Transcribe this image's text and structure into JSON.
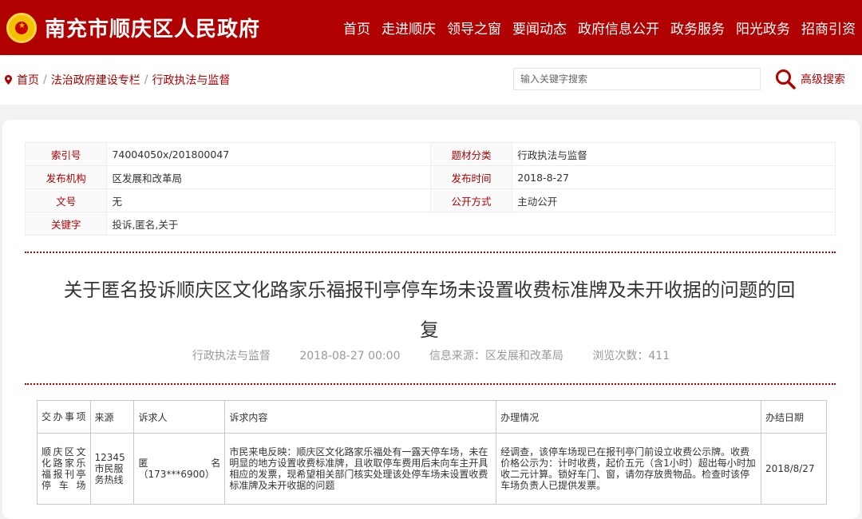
{
  "header": {
    "site_name": "南充市顺庆区人民政府",
    "nav": [
      "首页",
      "走进顺庆",
      "领导之窗",
      "要闻动态",
      "政府信息公开",
      "政务服务",
      "阳光政务",
      "招商引资"
    ]
  },
  "breadcrumb": {
    "items": [
      "首页",
      "法治政府建设专栏",
      "行政执法与监督"
    ],
    "separator": "/"
  },
  "search": {
    "placeholder": "输入关键字搜索",
    "advanced_label": "高级搜索"
  },
  "meta": {
    "index_label": "索引号",
    "index_value": "74004050x/201800047",
    "category_label": "题材分类",
    "category_value": "行政执法与监督",
    "publisher_label": "发布机构",
    "publisher_value": "区发展和改革局",
    "date_label": "发布时间",
    "date_value": "2018-8-27",
    "docno_label": "文号",
    "docno_value": "无",
    "mode_label": "公开方式",
    "mode_value": "主动公开",
    "keywords_label": "关键字",
    "keywords_value": "投诉,匿名,关于"
  },
  "article": {
    "title_line1": "关于匿名投诉顺庆区文化路家乐福报刊亭停车场未设置收费标准牌及未开收据的问题的回",
    "title_line2": "复",
    "column": "行政执法与监督",
    "datetime": "2018-08-27 00:00",
    "source_label": "信息来源：",
    "source_value": "区发展和改革局",
    "views_label": "浏览次数：",
    "views_value": "411"
  },
  "table": {
    "headers": [
      "交办事项",
      "来源",
      "诉求人",
      "诉求内容",
      "办理情况",
      "办结日期"
    ],
    "row": {
      "item": "顺庆区文化路家乐福报刊亭停车场",
      "source": "12345市民服务热线",
      "petitioner_name": "匿名",
      "petitioner_phone": "（173***6900）",
      "content": "市民来电反映：顺庆区文化路家乐福处有一露天停车场，未在明显的地方设置收费标准牌，且收取停车费用后未向车主开具相应的发票，现希望相关部门核实处理该处停车场未设置收费标准牌及未开收据的问题",
      "handling": "经调查，该停车场现已在报刊亭门前设立收费公示牌。收费价格公示为：计时收费，起价五元（含1小时）超出每小时加收二元计算。锁好车门、窗，请勿存放贵物品。检查时该停车场负责人已提供发票。",
      "completed_date": "2018/8/27"
    }
  },
  "colors": {
    "brand_red": "#b10000",
    "page_bg": "#f2f2f2",
    "dotted_line": "#b10000"
  }
}
